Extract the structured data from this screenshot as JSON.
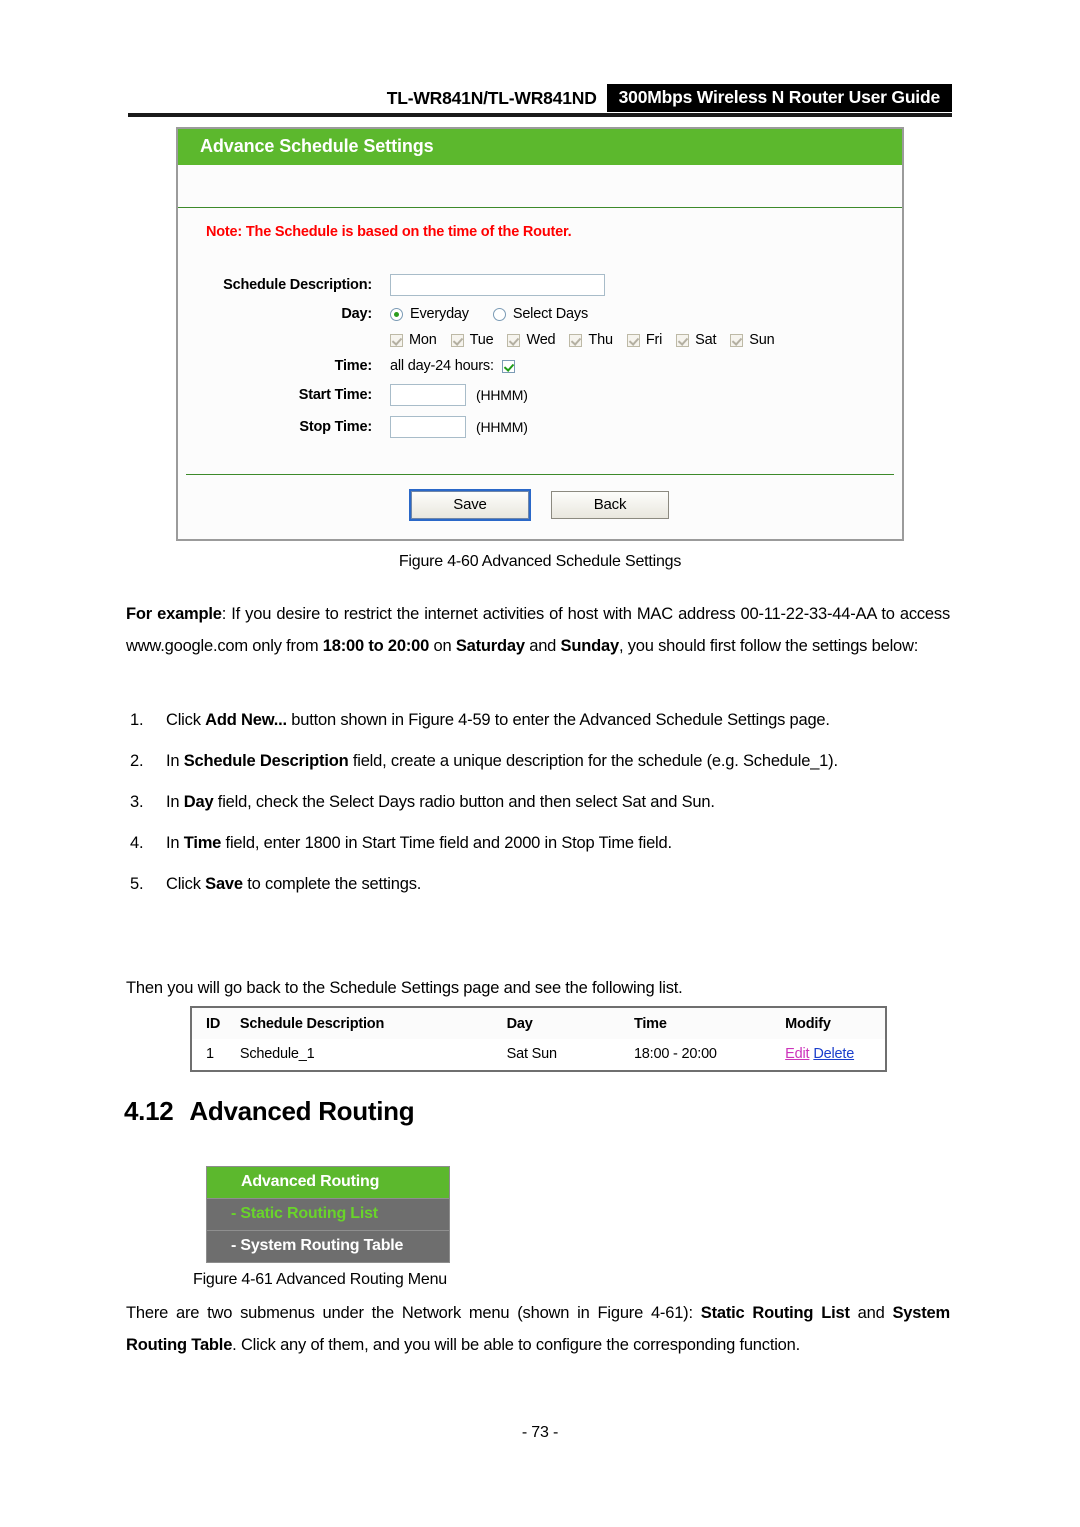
{
  "header": {
    "model": "TL-WR841N/TL-WR841ND",
    "guide_title": "300Mbps Wireless N Router User Guide"
  },
  "settings_panel": {
    "title": "Advance Schedule Settings",
    "note": "Note: The Schedule is based on the time of the Router.",
    "fields": {
      "schedule_description_label": "Schedule Description:",
      "schedule_description_value": "",
      "day_label": "Day:",
      "time_label": "Time:",
      "start_time_label": "Start Time:",
      "start_time_value": "",
      "stop_time_label": "Stop Time:",
      "stop_time_value": "",
      "hhmm_hint": "(HHMM)",
      "all_day_label": "all day-24 hours:"
    },
    "day_options": [
      {
        "label": "Everyday",
        "selected": true
      },
      {
        "label": "Select Days",
        "selected": false
      }
    ],
    "days": [
      {
        "label": "Mon",
        "checked": true
      },
      {
        "label": "Tue",
        "checked": true
      },
      {
        "label": "Wed",
        "checked": true
      },
      {
        "label": "Thu",
        "checked": true
      },
      {
        "label": "Fri",
        "checked": true
      },
      {
        "label": "Sat",
        "checked": true
      },
      {
        "label": "Sun",
        "checked": true
      }
    ],
    "buttons": {
      "save": "Save",
      "back": "Back"
    },
    "colors": {
      "header_green": "#5cb82d",
      "note_red": "#ff0000"
    }
  },
  "figures": {
    "fig_60_caption": "Figure 4-60   Advanced Schedule Settings",
    "fig_61_caption": "Figure 4-61 Advanced Routing Menu"
  },
  "body": {
    "example_paragraph_html": "<b>For example</b>: If you desire to restrict the internet activities of host with MAC address 00-11-22-33-44-AA to access www.google.com only from <b>18:00 to 20:00</b> on <b>Saturday</b> and <b>Sunday</b>, you should first follow the settings below:",
    "then_paragraph": "Then you will go back to the Schedule Settings page and see the following list.",
    "submenus_paragraph_html": "There are two submenus under the Network menu (shown in Figure 4-61): <b>Static Routing List</b> and <b>System Routing Table</b>. Click any of them, and you will be able to configure the corresponding function."
  },
  "steps": [
    {
      "num": "1.",
      "html": "Click <b>Add New...</b> button shown in Figure 4-59 to enter the Advanced Schedule Settings page."
    },
    {
      "num": "2.",
      "html": "In <b>Schedule Description</b> field, create a unique description for the schedule (e.g. Schedule_1)."
    },
    {
      "num": "3.",
      "html": "In <b>Day</b> field, check the Select Days radio button and then select Sat and Sun."
    },
    {
      "num": "4.",
      "html": "In <b>Time</b> field, enter 1800 in Start Time field and 2000 in Stop Time field."
    },
    {
      "num": "5.",
      "html": "Click <b>Save</b> to complete the settings."
    }
  ],
  "result_table": {
    "columns": [
      "ID",
      "Schedule Description",
      "Day",
      "Time",
      "Modify"
    ],
    "rows": [
      {
        "id": "1",
        "description": "Schedule_1",
        "day": "Sat  Sun",
        "time": "18:00 - 20:00",
        "edit_label": "Edit",
        "delete_label": "Delete"
      }
    ]
  },
  "section": {
    "number": "4.12",
    "title": "Advanced Routing"
  },
  "routing_menu": {
    "main": "Advanced Routing",
    "items": [
      {
        "label": "- Static Routing List",
        "highlighted": true
      },
      {
        "label": "- System Routing Table",
        "highlighted": false
      }
    ]
  },
  "footer": {
    "page_number": "- 73 -"
  }
}
